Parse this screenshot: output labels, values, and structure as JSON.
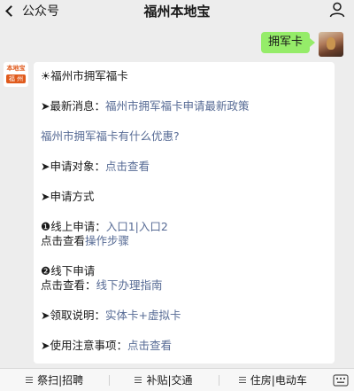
{
  "nav": {
    "back_label": "公众号",
    "title": "福州本地宝"
  },
  "outgoing": {
    "message": "拥军卡"
  },
  "brand": {
    "logo_top": "本地宝",
    "logo_bottom": "福 州"
  },
  "reply": {
    "heading": "☀福州市拥军福卡",
    "latest_label": "➤最新消息：",
    "latest_link": "福州市拥军福卡申请最新政策",
    "benefits_link": "福州市拥军福卡有什么优惠?",
    "target_label": "➤申请对象：",
    "target_link": "点击查看",
    "method_label": "➤申请方式",
    "online_label": "❶线上申请：",
    "online_link1": "入口1",
    "online_sep": "|",
    "online_link2": "入口2",
    "online_steps_prefix": "点击查看",
    "online_steps_link": "操作步骤",
    "offline_label": "❷线下申请",
    "offline_prefix": "点击查看：",
    "offline_link": "线下办理指南",
    "pickup_label": "➤领取说明：",
    "pickup_link": "实体卡+虚拟卡",
    "notes_label": "➤使用注意事项：",
    "notes_link": "点击查看"
  },
  "menu": [
    {
      "label": "祭扫|招聘"
    },
    {
      "label": "补贴|交通"
    },
    {
      "label": "住房|电动车"
    }
  ],
  "icons": {
    "back": "chevron-left-icon",
    "profile": "user-icon",
    "menu": "hamburger-icon",
    "keyboard": "keyboard-icon"
  }
}
